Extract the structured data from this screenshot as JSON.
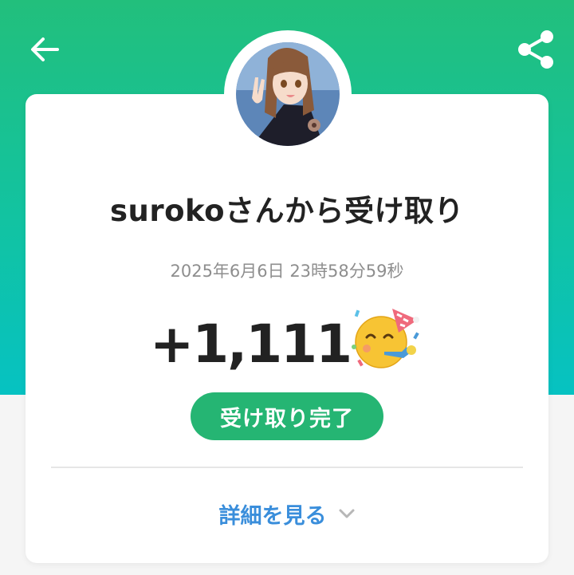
{
  "header": {
    "back_icon": "arrow-left-icon",
    "share_icon": "share-icon",
    "background_colors": [
      "#22bf7c",
      "#06c2c2"
    ]
  },
  "sender": {
    "avatar": "anime-character-avatar"
  },
  "receipt": {
    "title": "surokoさんから受け取り",
    "timestamp": "2025年6月6日 23時58分59秒",
    "amount": "+1,111",
    "emoji": "party-face-emoji",
    "status": "受け取り完了",
    "status_color": "#25b573"
  },
  "details": {
    "label": "詳細を見る",
    "chevron_icon": "chevron-down-icon",
    "link_color": "#3a8edb"
  }
}
